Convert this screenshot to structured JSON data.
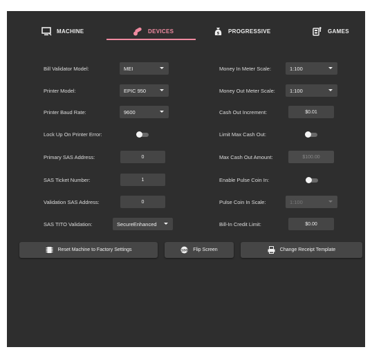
{
  "tabs": {
    "machine": "MACHINE",
    "devices": "DEVICES",
    "progressive": "PROGRESSIVE",
    "games": "GAMES",
    "active": "devices"
  },
  "colors": {
    "accent": "#f08aa0",
    "panel": "#2e2e2e",
    "field": "#454545"
  },
  "left": {
    "bill_validator_model": {
      "label": "Bill Validator Model:",
      "value": "MEI"
    },
    "printer_model": {
      "label": "Printer Model:",
      "value": "EPIC 950"
    },
    "printer_baud_rate": {
      "label": "Printer Baud Rate:",
      "value": "9600"
    },
    "lock_up_on_printer_error": {
      "label": "Lock Up On Printer Error:",
      "on": false
    },
    "primary_sas_address": {
      "label": "Primary SAS Address:",
      "value": "0"
    },
    "sas_ticket_number": {
      "label": "SAS Ticket Number:",
      "value": "1"
    },
    "validation_sas_address": {
      "label": "Validation SAS Address:",
      "value": "0"
    },
    "sas_tito_validation": {
      "label": "SAS TITO Validation:",
      "value": "SecureEnhanced"
    }
  },
  "right": {
    "money_in_meter_scale": {
      "label": "Money In Meter Scale:",
      "value": "1:100"
    },
    "money_out_meter_scale": {
      "label": "Money Out Meter Scale:",
      "value": "1:100"
    },
    "cash_out_increment": {
      "label": "Cash Out Increment:",
      "value": "$0.01"
    },
    "limit_max_cash_out": {
      "label": "Limit Max Cash Out:",
      "on": false
    },
    "max_cash_out_amount": {
      "label": "Max Cash Out Amount:",
      "value": "$100.00"
    },
    "enable_pulse_coin_in": {
      "label": "Enable Pulse Coin In:",
      "on": false
    },
    "pulse_coin_in_scale": {
      "label": "Pulse Coin In Scale:",
      "value": "1:100"
    },
    "bill_in_credit_limit": {
      "label": "Bill-In Credit Limit:",
      "value": "$0.00"
    }
  },
  "buttons": {
    "reset": "Reset Machine to Factory Settings",
    "flip": "Flip Screen",
    "receipt": "Change Receipt Template"
  },
  "icons": {
    "machine": "monitor-icon",
    "devices": "pills-icon",
    "progressive": "money-bag-icon",
    "games": "games-icon",
    "reset": "chip-icon",
    "flip": "rotate-180-icon",
    "receipt": "receipt-printer-icon"
  }
}
